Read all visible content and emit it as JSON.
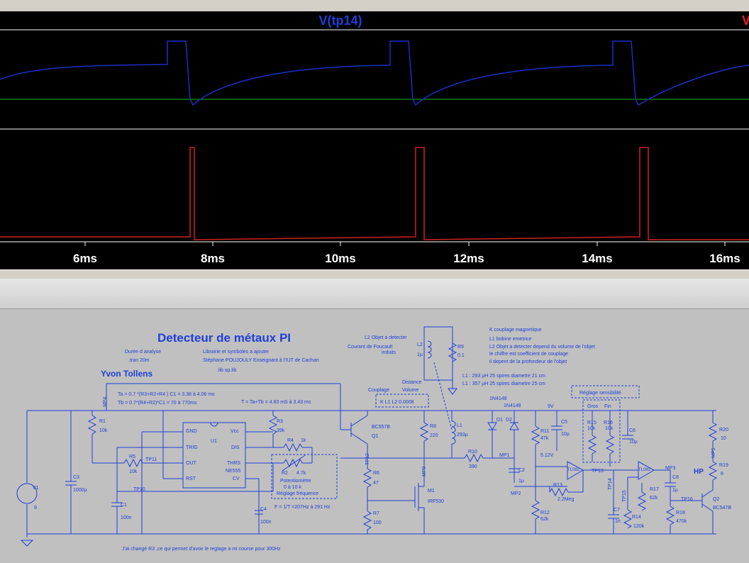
{
  "waveform": {
    "trace1_label": "V(tp14)",
    "trace2_label_partial": "V",
    "x_ticks": [
      "6ms",
      "8ms",
      "10ms",
      "12ms",
      "14ms",
      "16ms"
    ],
    "colors": {
      "trace1": "#1a2fc6",
      "trace2": "#d02020",
      "zero": "#00c000",
      "label1": "#1f3fd8",
      "label2": "#e02020",
      "axis": "#ffffff"
    }
  },
  "schematic": {
    "title": "Detecteur de métaux PI",
    "author": "Yvon Tollens",
    "notes": {
      "duree": "Durée d analyse",
      "tran": ".tran 20m",
      "lib_line1": "Librairie et symboles a ajouter",
      "lib_line2": "Stéphane POUJOULY  Enseignant à l'IUT de Cachan",
      "lib_line3": ".lib sp.lib",
      "ta": "Ta = 0.7 *(R3+R2+R4 ) C1 = 3.38 à 4.06 ms",
      "tb": "Tb = 0.7*(R4+R2)*C1 = 70 à 770ms",
      "t": "T = Ta+Tb = 4.83 mS à 3.43 ms",
      "l2_obj": "L2  Objet a detecter",
      "courant1": "Courant de Foucault",
      "courant2": "induits",
      "k1": "K  couplage magnetique",
      "k2": "L1  bobine emetrice",
      "k3": "L2  Objet a detecter depend du volume de l'objet",
      "k4": "le chiffre est coefficient de  couplage",
      "k5": "il depent de la profondeur de l'objet",
      "l1a": "L1 : 293 µH  25 spires diametre 21 cm",
      "l1b": "L1 : 357 µH  25 spires diametre 25 cm",
      "couplage": "Couplage",
      "distance1": "Distance",
      "distance2": "Volume",
      "kl1l2": "K L1 L2  0.0008",
      "reglage_sens": "Réglage sensibilité",
      "gros": "Gros",
      "fin": "Fin",
      "pot1": "Potentiomètre",
      "pot2": "0 à 10 k",
      "pot3": "Réglage fréquence",
      "freq": "F = 1/T =207Hz à 291 Hz",
      "footer": "J'ai changé R3 ,ce qui permet d'avoir le reglage a mi course  pour  300Hz",
      "hp": "HP",
      "v9": "9V",
      "v512": "5.12V"
    },
    "components": {
      "v1": "V1",
      "v1v": "9",
      "r1": "R1",
      "r1v": "10k",
      "c3": "C3",
      "c3v": "1000µ",
      "r5": "R5",
      "r5v": "10k",
      "c1": "C1",
      "c1v": "100n",
      "u1": "U1",
      "ne555": "NE555",
      "gnd": "GND",
      "trig": "TRIG",
      "out": "OUT",
      "rst": "RST",
      "vcc": "Vcc",
      "dis": "DIS",
      "thrs": "THRS",
      "cv": "CV",
      "r3": "R3",
      "r3v": "39k",
      "r4": "R4",
      "r4v": "1k",
      "r2": "R2",
      "r2v": "4.7k",
      "c4": "C4",
      "c4v": "100n",
      "q1": "Q1",
      "bc557b": "BC557B",
      "r8": "R8",
      "r8v": "220",
      "r6": "R6",
      "r6v": "47",
      "r7": "R7",
      "r7v": "100",
      "m1": "M1",
      "irf530": "IRF530",
      "l1": "L1",
      "l1v": "293µ",
      "l2": "L2",
      "l2v": "1µ",
      "r9": "R9",
      "r9v": "0.1",
      "r10": "R10",
      "r10v": "390",
      "d1": "D1",
      "d2": "D2",
      "d1n": "1N4148",
      "d2n": "1N4148",
      "r11": "R11",
      "r11v": "47k",
      "c5": "C5",
      "c5v": "10µ",
      "c2": "C2",
      "c2v": "1µ",
      "r12": "R12",
      "r12v": "62k",
      "r13": "R13",
      "r13v": "2.2Meg",
      "r15": "R15",
      "r15v": "10k",
      "r16": "R16",
      "r16v": "10k",
      "c6": "C6",
      "c6v": "10µ",
      "c7": "C7",
      "c7v": "1n",
      "r14": "R14",
      "r14v": "120k",
      "r17": "R17",
      "r17v": "62k",
      "c8": "C8",
      "c8v": "1µ",
      "r18": "R18",
      "r18v": "470k",
      "r20": "R20",
      "r20v": "10",
      "r19": "R19",
      "r19v": "8",
      "q2": "Q2",
      "bc547b": "BC547B",
      "tl082": "TL082",
      "mp4": "MP4",
      "tp11": "TP11",
      "tp10": "TP10",
      "tp12": "TP12",
      "mp0": "MP0",
      "mp1": "MP1",
      "mp2": "MP2",
      "tp13": "TP13",
      "tp14": "TP14",
      "tp15": "TP15",
      "mp3": "MP3",
      "mp5": "MP5",
      "tp16": "TP16"
    }
  }
}
